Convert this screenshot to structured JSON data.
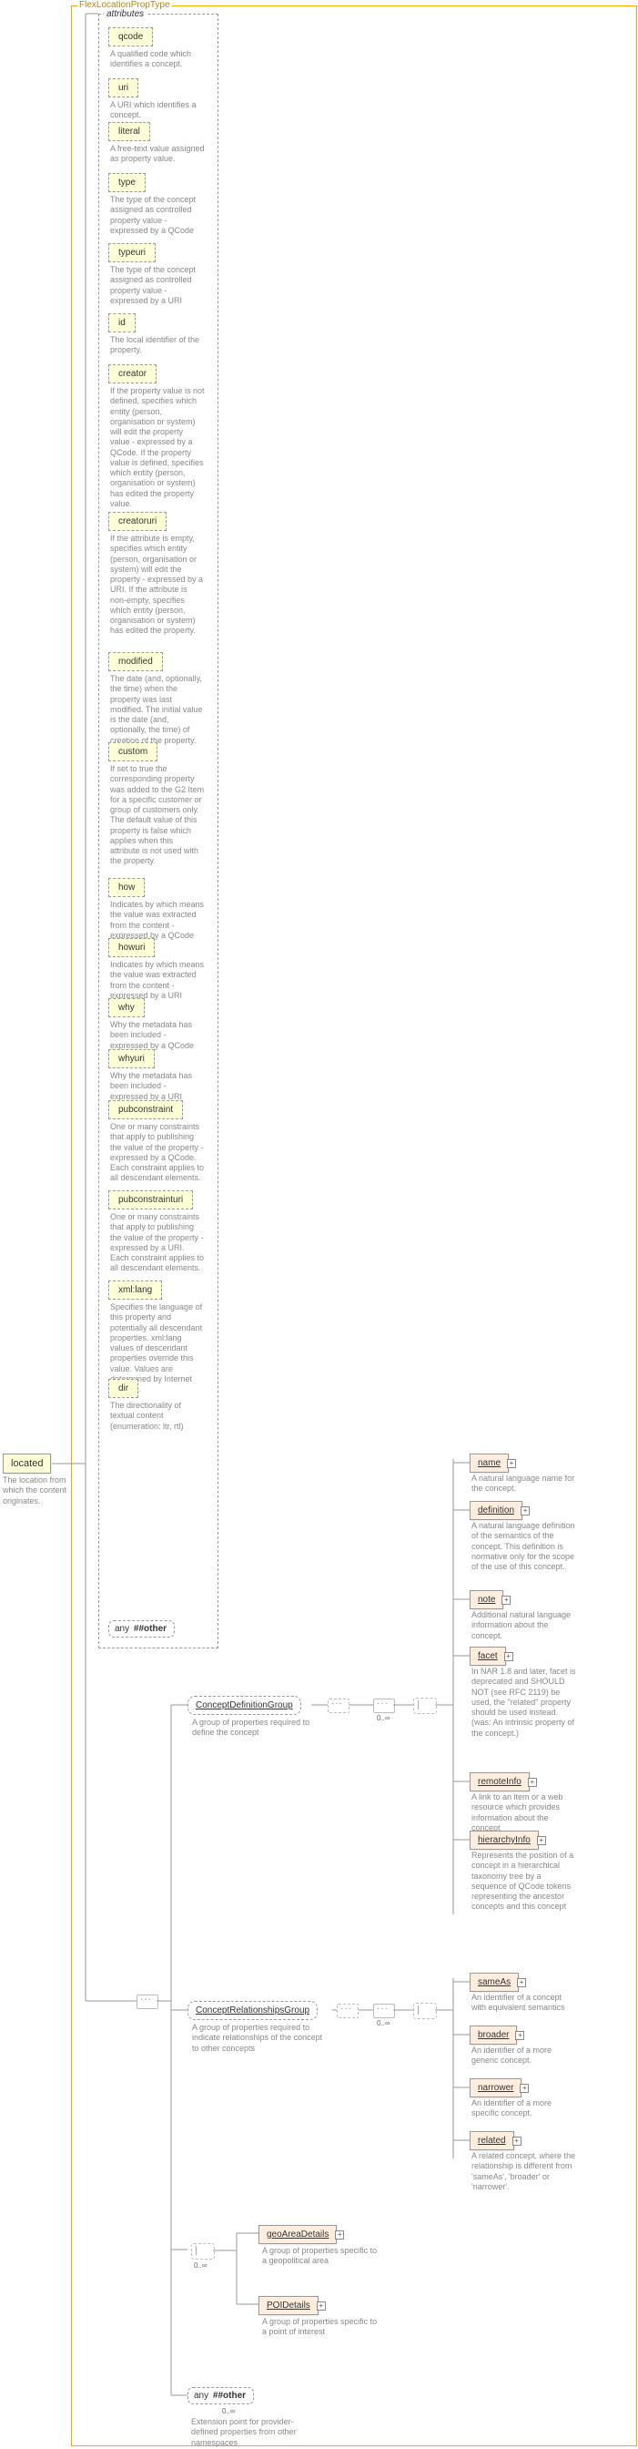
{
  "root": {
    "title": "FlexLocationPropType",
    "main_element": "located",
    "main_doc": "The location from which the content originates."
  },
  "attributes_label": "attributes",
  "attrs": [
    {
      "name": "qcode",
      "doc": "A qualified code which identifies a concept."
    },
    {
      "name": "uri",
      "doc": "A URI which identifies a concept."
    },
    {
      "name": "literal",
      "doc": "A free-text value assigned as property value."
    },
    {
      "name": "type",
      "doc": "The type of the concept assigned as controlled property value - expressed by a QCode"
    },
    {
      "name": "typeuri",
      "doc": "The type of the concept assigned as controlled property value - expressed by a URI"
    },
    {
      "name": "id",
      "doc": "The local identifier of the property."
    },
    {
      "name": "creator",
      "doc": "If the property value is not defined, specifies which entity (person, organisation or system) will edit the property value - expressed by a QCode. If the property value is defined, specifies which entity (person, organisation or system) has edited the property value."
    },
    {
      "name": "creatoruri",
      "doc": "If the attribute is empty, specifies which entity (person, organisation or system) will edit the property - expressed by a URI. If the attribute is non-empty, specifies which entity (person, organisation or system) has edited the property."
    },
    {
      "name": "modified",
      "doc": "The date (and, optionally, the time) when the property was last modified. The initial value is the date (and, optionally, the time) of creation of the property."
    },
    {
      "name": "custom",
      "doc": "If set to true the corresponding property was added to the G2 Item for a specific customer or group of customers only. The default value of this property is false which applies when this attribute is not used with the property."
    },
    {
      "name": "how",
      "doc": "Indicates by which means the value was extracted from the content - expressed by a QCode"
    },
    {
      "name": "howuri",
      "doc": "Indicates by which means the value was extracted from the content - expressed by a URI"
    },
    {
      "name": "why",
      "doc": "Why the metadata has been included - expressed by a QCode"
    },
    {
      "name": "whyuri",
      "doc": "Why the metadata has been included - expressed by a URI"
    },
    {
      "name": "pubconstraint",
      "doc": "One or many constraints that apply to publishing the value of the property - expressed by a QCode. Each constraint applies to all descendant elements."
    },
    {
      "name": "pubconstrainturi",
      "doc": "One or many constraints that apply to publishing the value of the property - expressed by a URI. Each constraint applies to all descendant elements."
    },
    {
      "name": "xml:lang",
      "doc": "Specifies the language of this property and potentially all descendant properties. xml:lang values of descendant properties override this value. Values are determined by Internet BCP 47."
    },
    {
      "name": "dir",
      "doc": "The directionality of textual content (enumeration: ltr, rtl)"
    }
  ],
  "attr_any": {
    "label_any": "any",
    "label_ns": "##other"
  },
  "groups": {
    "cdg": {
      "name": "ConceptDefinitionGroup",
      "doc": "A group of properties required to define the concept"
    },
    "crg": {
      "name": "ConceptRelationshipsGroup",
      "doc": "A group of properties required to indicate relationships of the concept to other concepts"
    },
    "geo": {
      "name": "geoAreaDetails",
      "doc": "A group of properties specific to a geopolitical area"
    },
    "poi": {
      "name": "POIDetails",
      "doc": "A group of properties specific to a point of interest"
    }
  },
  "cardinality": "0..∞",
  "body_any": {
    "label_any": "any",
    "label_ns": "##other",
    "doc": "Extension point for provider-defined properties from other namespaces"
  },
  "cdg_children": [
    {
      "name": "name",
      "doc": "A natural language name for the concept."
    },
    {
      "name": "definition",
      "doc": "A natural language definition of the semantics of the concept. This definition is normative only for the scope of the use of this concept."
    },
    {
      "name": "note",
      "doc": "Additional natural language information about the concept."
    },
    {
      "name": "facet",
      "doc": "In NAR 1.8 and later, facet is deprecated and SHOULD NOT (see RFC 2119) be used, the \"related\" property should be used instead. (was: An intrinsic property of the concept.)"
    },
    {
      "name": "remoteInfo",
      "doc": "A link to an item or a web resource which provides information about the concept"
    },
    {
      "name": "hierarchyInfo",
      "doc": "Represents the position of a concept in a hierarchical taxonomy tree by a sequence of QCode tokens representing the ancestor concepts and this concept"
    }
  ],
  "crg_children": [
    {
      "name": "sameAs",
      "doc": "An identifier of a concept with equivalent semantics"
    },
    {
      "name": "broader",
      "doc": "An identifier of a more generic concept."
    },
    {
      "name": "narrower",
      "doc": "An identifier of a more specific concept."
    },
    {
      "name": "related",
      "doc": "A related concept, where the relationship is different from 'sameAs', 'broader' or 'narrower'."
    }
  ]
}
